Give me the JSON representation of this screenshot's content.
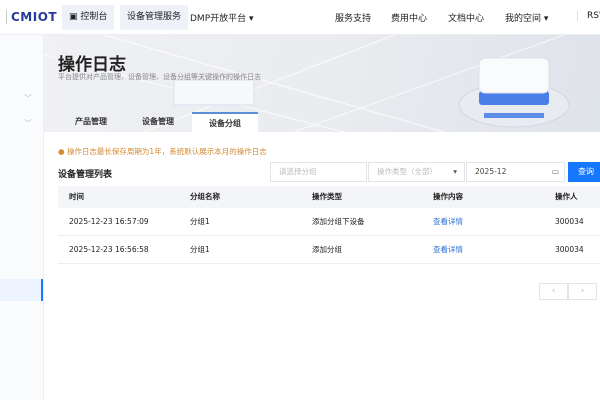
{
  "topbar": {
    "logo": "CMIOT",
    "console": "控制台",
    "service": "设备管理服务",
    "dmp": "DMP开放平台 ▾",
    "nav": [
      "服务支持",
      "费用中心",
      "文档中心",
      "我的空间 ▾"
    ],
    "user": "RSW"
  },
  "page": {
    "title": "操作日志",
    "subtitle": "平台提供对产品管理、设备管理、设备分组等关键操作的操作日志",
    "tabs": [
      {
        "label": "产品管理"
      },
      {
        "label": "设备管理"
      },
      {
        "label": "设备分组",
        "active": true
      }
    ]
  },
  "notice": "操作日志最长保存周期为1年，系统默认展示本月的操作日志",
  "list": {
    "title": "设备管理列表",
    "group_placeholder": "请选择分组",
    "type_placeholder": "操作类型（全部）",
    "month": "2025-12",
    "query": "查询"
  },
  "table": {
    "columns": [
      "时间",
      "分组名称",
      "操作类型",
      "操作内容",
      "操作人"
    ],
    "rows": [
      [
        "2025-12-23 16:57:09",
        "分组1",
        "添加分组下设备",
        "查看详情",
        "300034"
      ],
      [
        "2025-12-23 16:56:58",
        "分组1",
        "添加分组",
        "查看详情",
        "300034"
      ]
    ]
  },
  "pagination": {
    "prev": "‹",
    "next": "›"
  },
  "colors": {
    "accent": "#1677ff",
    "warning": "#d48a30",
    "link": "#2a6fd6"
  }
}
